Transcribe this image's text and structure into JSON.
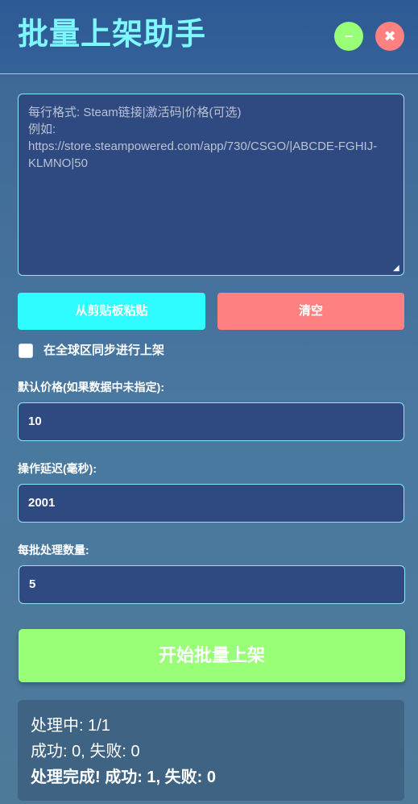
{
  "header": {
    "title": "批量上架助手",
    "minimize_glyph": "−",
    "close_glyph": "✖"
  },
  "input": {
    "placeholder": "每行格式: Steam链接|激活码|价格(可选)\n例如:\nhttps://store.steampowered.com/app/730/CSGO/|ABCDE-FGHIJ-KLMNO|50",
    "value": ""
  },
  "actions": {
    "paste_label": "从剪贴板粘贴",
    "clear_label": "清空"
  },
  "options": {
    "global_sync_label": "在全球区同步进行上架",
    "global_sync_checked": false
  },
  "fields": {
    "default_price_label": "默认价格(如果数据中未指定):",
    "default_price_value": "10",
    "delay_label": "操作延迟(毫秒):",
    "delay_value": "2001",
    "batch_size_label": "每批处理数量:",
    "batch_size_value": "5"
  },
  "start_label": "开始批量上架",
  "status": {
    "line1": "处理中: 1/1",
    "line2": "成功: 0, 失败: 0",
    "line3": "处理完成! 成功: 1, 失败: 0"
  },
  "colors": {
    "title": "#7ff7ff",
    "minimize": "#99ff77",
    "close": "#ff8080",
    "paste": "#2efcff",
    "clear": "#ff8080",
    "start": "#99ff77",
    "input_bg": "#2f4a80",
    "input_border": "#8fe6f5"
  }
}
